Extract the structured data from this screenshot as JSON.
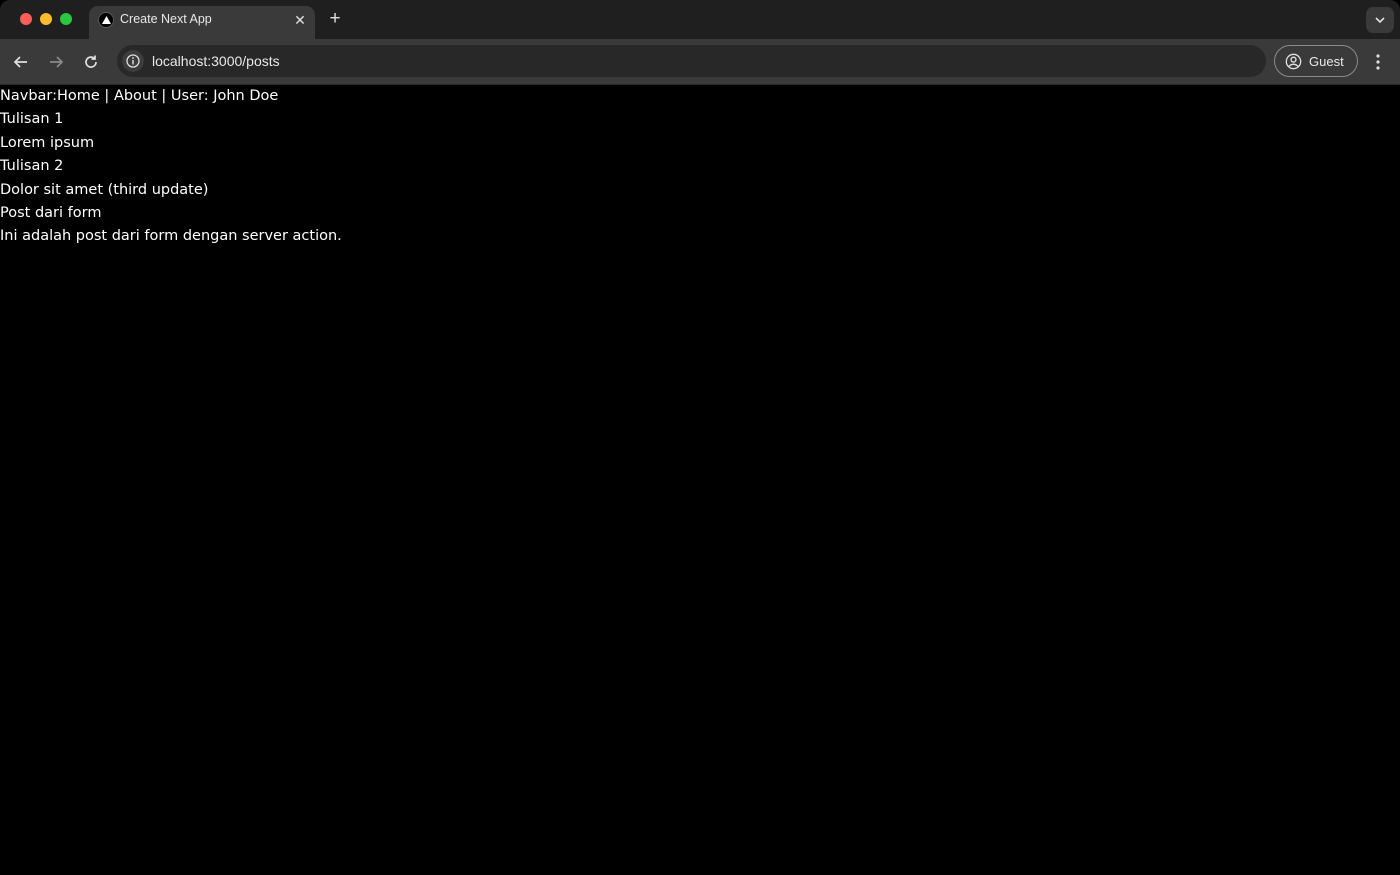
{
  "browser": {
    "tab": {
      "title": "Create Next App"
    },
    "address_bar": {
      "url": "localhost:3000/posts"
    },
    "profile": {
      "label": "Guest"
    }
  },
  "page": {
    "navbar": {
      "prefix": "Navbar:",
      "home": "Home",
      "sep1": " | ",
      "about": "About",
      "sep2": " | ",
      "user": "User: John Doe"
    },
    "posts": [
      {
        "title": "Tulisan 1",
        "body": "Lorem ipsum"
      },
      {
        "title": "Tulisan 2",
        "body": "Dolor sit amet (third update)"
      },
      {
        "title": "Post dari form",
        "body": "Ini adalah post dari form dengan server action."
      }
    ]
  }
}
